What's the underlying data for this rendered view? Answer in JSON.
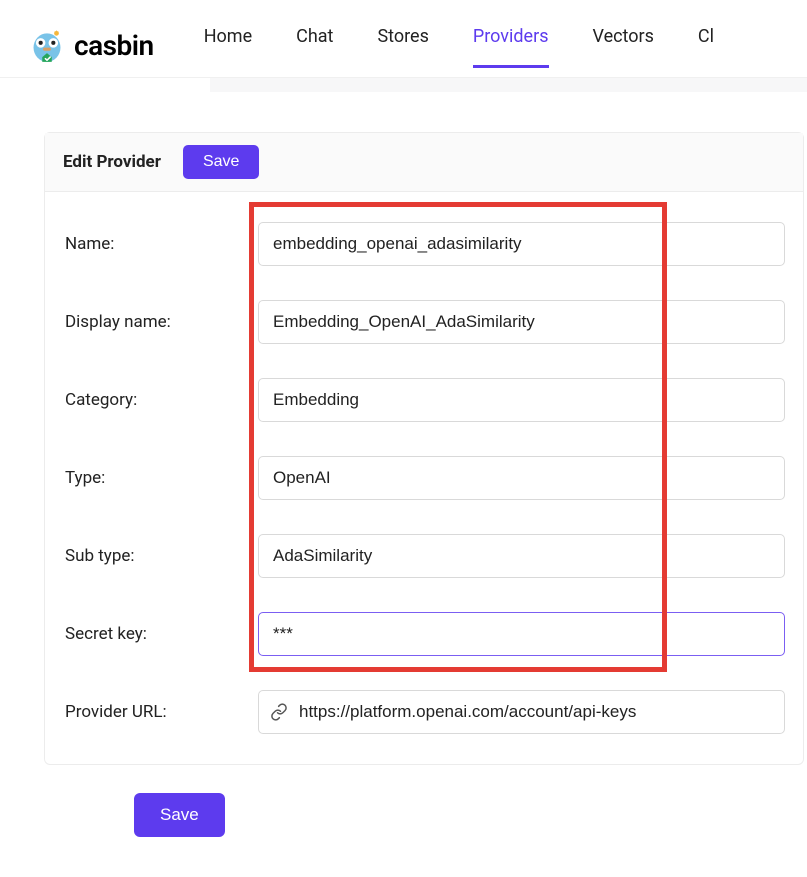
{
  "brand": {
    "name": "casbin"
  },
  "nav": {
    "items": [
      {
        "label": "Home",
        "active": false
      },
      {
        "label": "Chat",
        "active": false
      },
      {
        "label": "Stores",
        "active": false
      },
      {
        "label": "Providers",
        "active": true
      },
      {
        "label": "Vectors",
        "active": false
      },
      {
        "label": "Cl",
        "active": false
      }
    ]
  },
  "card": {
    "title": "Edit Provider",
    "save_label": "Save"
  },
  "form": {
    "name": {
      "label": "Name:",
      "value": "embedding_openai_adasimilarity"
    },
    "display_name": {
      "label": "Display name:",
      "value": "Embedding_OpenAI_AdaSimilarity"
    },
    "category": {
      "label": "Category:",
      "value": "Embedding"
    },
    "type": {
      "label": "Type:",
      "value": "OpenAI"
    },
    "sub_type": {
      "label": "Sub type:",
      "value": "AdaSimilarity"
    },
    "secret_key": {
      "label": "Secret key:",
      "value": "***"
    },
    "provider_url": {
      "label": "Provider URL:",
      "value": "https://platform.openai.com/account/api-keys"
    }
  },
  "footer": {
    "save_label": "Save"
  }
}
